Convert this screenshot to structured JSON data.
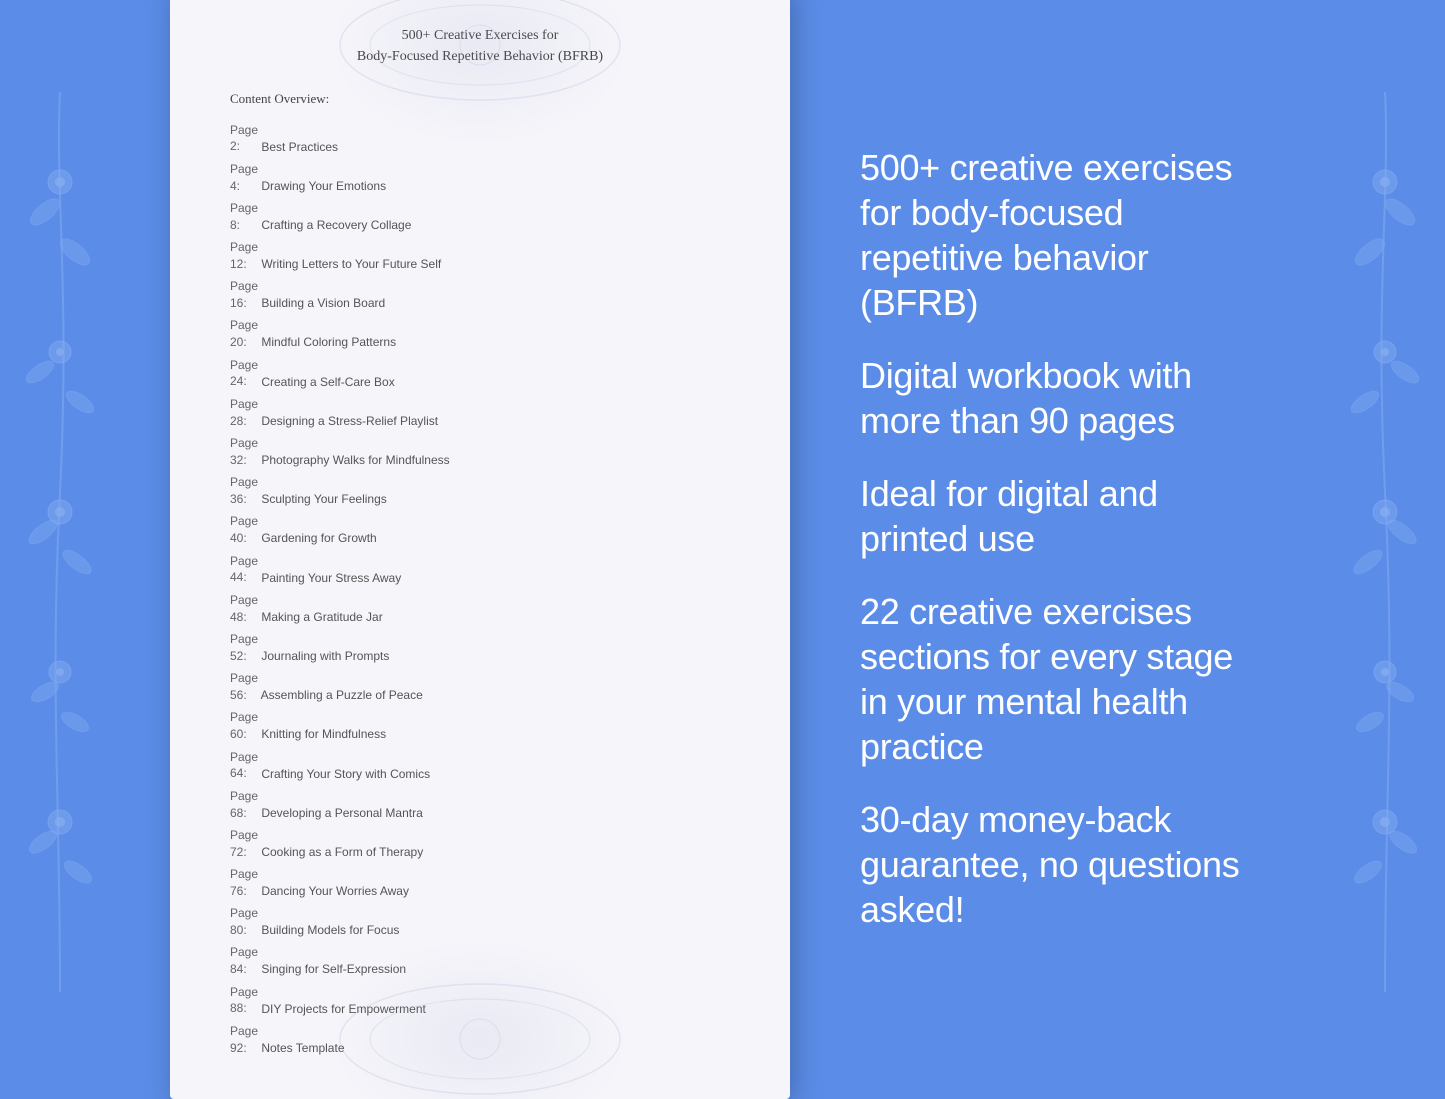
{
  "background_color": "#5b8de8",
  "floral": {
    "left_label": "floral-decoration-left",
    "right_label": "floral-decoration-right"
  },
  "book": {
    "title_line1": "500+ Creative Exercises for",
    "title_line2": "Body-Focused Repetitive Behavior (BFRB)",
    "content_overview_label": "Content Overview:",
    "toc": [
      {
        "page": "2",
        "title": "Best Practices"
      },
      {
        "page": "4",
        "title": "Drawing Your Emotions"
      },
      {
        "page": "8",
        "title": "Crafting a Recovery Collage"
      },
      {
        "page": "12",
        "title": "Writing Letters to Your Future Self"
      },
      {
        "page": "16",
        "title": "Building a Vision Board"
      },
      {
        "page": "20",
        "title": "Mindful Coloring Patterns"
      },
      {
        "page": "24",
        "title": "Creating a Self-Care Box"
      },
      {
        "page": "28",
        "title": "Designing a Stress-Relief Playlist"
      },
      {
        "page": "32",
        "title": "Photography Walks for Mindfulness"
      },
      {
        "page": "36",
        "title": "Sculpting Your Feelings"
      },
      {
        "page": "40",
        "title": "Gardening for Growth"
      },
      {
        "page": "44",
        "title": "Painting Your Stress Away"
      },
      {
        "page": "48",
        "title": "Making a Gratitude Jar"
      },
      {
        "page": "52",
        "title": "Journaling with Prompts"
      },
      {
        "page": "56",
        "title": "Assembling a Puzzle of Peace"
      },
      {
        "page": "60",
        "title": "Knitting for Mindfulness"
      },
      {
        "page": "64",
        "title": "Crafting Your Story with Comics"
      },
      {
        "page": "68",
        "title": "Developing a Personal Mantra"
      },
      {
        "page": "72",
        "title": "Cooking as a Form of Therapy"
      },
      {
        "page": "76",
        "title": "Dancing Your Worries Away"
      },
      {
        "page": "80",
        "title": "Building Models for Focus"
      },
      {
        "page": "84",
        "title": "Singing for Self-Expression"
      },
      {
        "page": "88",
        "title": "DIY Projects for Empowerment"
      },
      {
        "page": "92",
        "title": "Notes Template"
      }
    ]
  },
  "info": {
    "blocks": [
      {
        "text": "500+ creative exercises for body-focused repetitive behavior (BFRB)"
      },
      {
        "text": "Digital workbook with more than 90 pages"
      },
      {
        "text": "Ideal for digital and printed use"
      },
      {
        "text": "22 creative exercises sections for every stage in your mental health practice"
      },
      {
        "text": "30-day money-back guarantee, no questions asked!"
      }
    ]
  }
}
